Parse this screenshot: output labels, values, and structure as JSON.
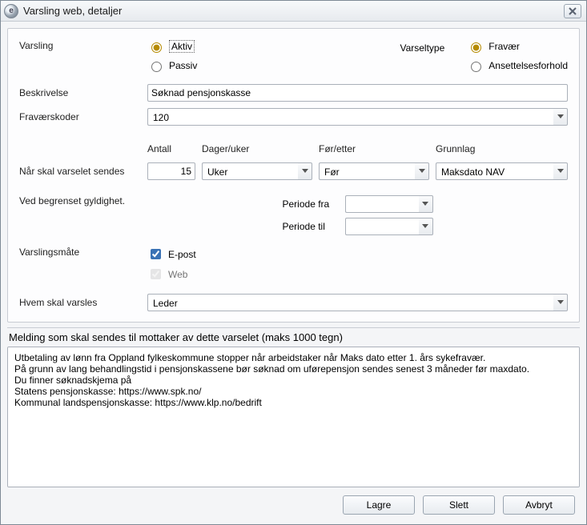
{
  "window": {
    "title": "Varsling web, detaljer"
  },
  "labels": {
    "varsling": "Varsling",
    "varseltype": "Varseltype",
    "beskrivelse": "Beskrivelse",
    "fravaerskoder": "Fraværskoder",
    "antall": "Antall",
    "dager_uker": "Dager/uker",
    "for_etter": "Før/etter",
    "grunnlag": "Grunnlag",
    "naar_sendes": "Når skal varselet sendes",
    "ved_begrenset": "Ved begrenset gyldighet.",
    "periode_fra": "Periode fra",
    "periode_til": "Periode til",
    "varslingsmate": "Varslingsmåte",
    "hvem_varsles": "Hvem skal varsles",
    "msg_header": "Melding som skal sendes til mottaker av dette varselet (maks 1000 tegn)"
  },
  "varsling": {
    "options": {
      "aktiv": "Aktiv",
      "passiv": "Passiv"
    },
    "selected": "aktiv"
  },
  "varseltype": {
    "options": {
      "fravaer": "Fravær",
      "ansettelsesforhold": "Ansettelsesforhold"
    },
    "selected": "fravaer"
  },
  "beskrivelse_value": "Søknad pensjonskasse",
  "fravaerskoder_value": "120",
  "timing": {
    "antall": "15",
    "dager_uker_value": "Uker",
    "for_etter_value": "Før",
    "grunnlag_value": "Maksdato NAV"
  },
  "periode": {
    "fra": "",
    "til": ""
  },
  "varslingsmate": {
    "epost_label": "E-post",
    "epost_checked": true,
    "web_label": "Web",
    "web_checked": true,
    "web_disabled": true
  },
  "hvem_value": "Leder",
  "message_text": "Utbetaling av lønn fra Oppland fylkeskommune stopper når arbeidstaker når Maks dato etter 1. års sykefravær.\nPå grunn av lang behandlingstid i pensjonskassene bør søknad om uførepensjon sendes senest 3 måneder før maxdato.\nDu finner søknadskjema på\nStatens pensjonskasse: https://www.spk.no/\nKommunal landspensjonskasse: https://www.klp.no/bedrift",
  "buttons": {
    "lagre": "Lagre",
    "slett": "Slett",
    "avbryt": "Avbryt"
  }
}
